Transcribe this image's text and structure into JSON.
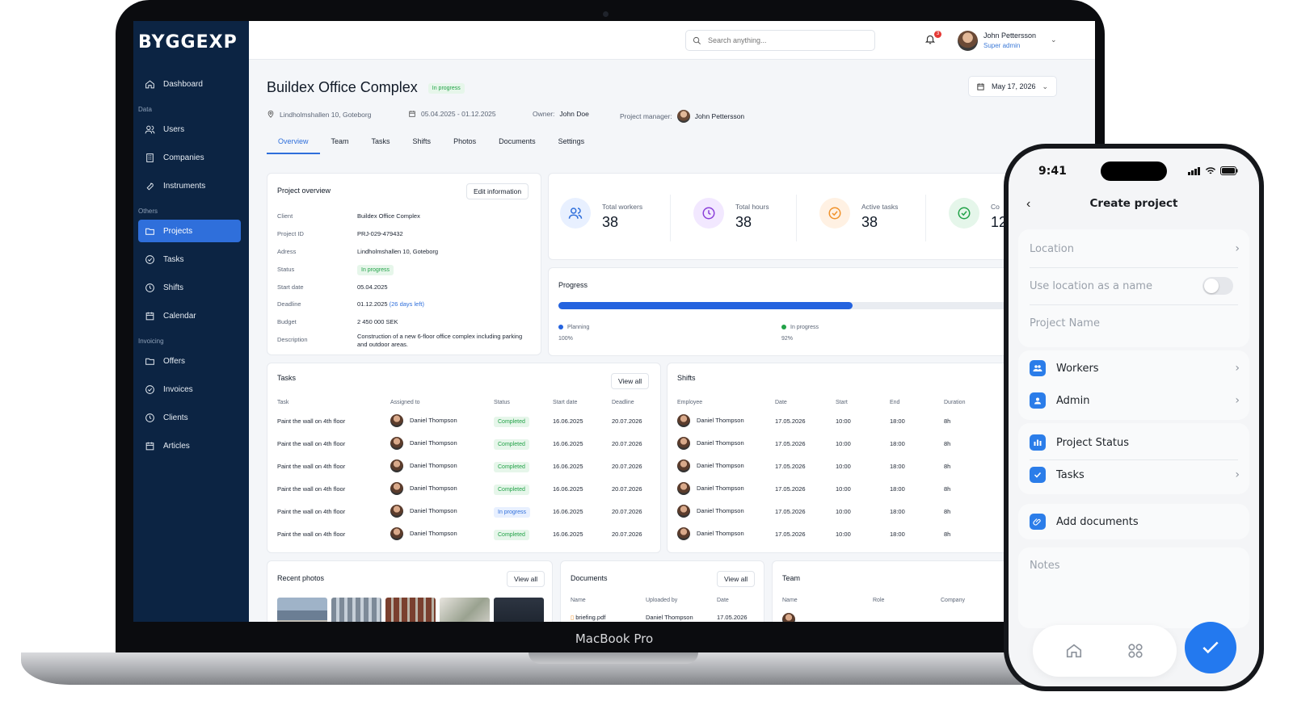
{
  "device": {
    "laptop_label": "MacBook Pro"
  },
  "app": {
    "brand": "BYGGEXP",
    "search_placeholder": "Search anything...",
    "notification_count": "3",
    "user": {
      "name": "John Pettersson",
      "role": "Super admin"
    }
  },
  "sidebar": {
    "dashboard": "Dashboard",
    "group_data": "Data",
    "users": "Users",
    "companies": "Companies",
    "instruments": "Instruments",
    "group_others": "Others",
    "projects": "Projects",
    "tasks": "Tasks",
    "shifts": "Shifts",
    "calendar": "Calendar",
    "group_invoicing": "Invoicing",
    "offers": "Offers",
    "invoices": "Invoices",
    "clients": "Clients",
    "articles": "Articles"
  },
  "header": {
    "title": "Buildex Office Complex",
    "status": "In progress",
    "address": "Lindholmshallen 10, Goteborg",
    "dates": "05.04.2025 - 01.12.2025",
    "owner_label": "Owner:",
    "owner": "John Doe",
    "pm_label": "Project manager:",
    "pm": "John Pettersson",
    "date_picker": "May 17, 2026"
  },
  "tabs": [
    "Overview",
    "Team",
    "Tasks",
    "Shifts",
    "Photos",
    "Documents",
    "Settings"
  ],
  "overview": {
    "title": "Project overview",
    "edit_button": "Edit information",
    "rows": {
      "client_label": "Client",
      "client": "Buildex Office Complex",
      "id_label": "Project ID",
      "id": "PRJ-029-479432",
      "address_label": "Adress",
      "address": "Lindholmshallen 10, Goteborg",
      "status_label": "Status",
      "status": "In progress",
      "start_label": "Start date",
      "start": "05.04.2025",
      "deadline_label": "Deadline",
      "deadline": "01.12.2025",
      "deadline_note": "(26 days left)",
      "budget_label": "Budget",
      "budget": "2 450 000 SEK",
      "description_label": "Description",
      "description": "Construction of a new 6-floor office complex including parking and outdoor areas."
    }
  },
  "stats": [
    {
      "label": "Total workers",
      "value": "38"
    },
    {
      "label": "Total hours",
      "value": "38"
    },
    {
      "label": "Active tasks",
      "value": "38"
    },
    {
      "label": "Co",
      "value": "12"
    }
  ],
  "progress": {
    "title": "Progress",
    "fill_fraction": 0.65,
    "planning_label": "Planning",
    "planning_value": "100%",
    "inprogress_label": "In progress",
    "inprogress_value": "92%"
  },
  "tasks": {
    "title": "Tasks",
    "view_all": "View all",
    "headers": [
      "Task",
      "Assigned to",
      "Status",
      "Start date",
      "Deadline"
    ],
    "rows": [
      [
        "Paint the wall on 4th floor",
        "Daniel Thompson",
        "Completed",
        "16.06.2025",
        "20.07.2026"
      ],
      [
        "Paint the wall on 4th floor",
        "Daniel Thompson",
        "Completed",
        "16.06.2025",
        "20.07.2026"
      ],
      [
        "Paint the wall on 4th floor",
        "Daniel Thompson",
        "Completed",
        "16.06.2025",
        "20.07.2026"
      ],
      [
        "Paint the wall on 4th floor",
        "Daniel Thompson",
        "Completed",
        "16.06.2025",
        "20.07.2026"
      ],
      [
        "Paint the wall on 4th floor",
        "Daniel Thompson",
        "In progress",
        "16.06.2025",
        "20.07.2026"
      ],
      [
        "Paint the wall on 4th floor",
        "Daniel Thompson",
        "Completed",
        "16.06.2025",
        "20.07.2026"
      ]
    ]
  },
  "shifts": {
    "title": "Shifts",
    "headers": [
      "Employee",
      "Date",
      "Start",
      "End",
      "Duration"
    ],
    "rows": [
      [
        "Daniel Thompson",
        "17.05.2026",
        "10:00",
        "18:00",
        "8h"
      ],
      [
        "Daniel Thompson",
        "17.05.2026",
        "10:00",
        "18:00",
        "8h"
      ],
      [
        "Daniel Thompson",
        "17.05.2026",
        "10:00",
        "18:00",
        "8h"
      ],
      [
        "Daniel Thompson",
        "17.05.2026",
        "10:00",
        "18:00",
        "8h"
      ],
      [
        "Daniel Thompson",
        "17.05.2026",
        "10:00",
        "18:00",
        "8h"
      ],
      [
        "Daniel Thompson",
        "17.05.2026",
        "10:00",
        "18:00",
        "8h"
      ]
    ]
  },
  "photos": {
    "title": "Recent photos",
    "view_all": "View all"
  },
  "documents": {
    "title": "Documents",
    "view_all": "View all",
    "headers": [
      "Name",
      "Uploaded by",
      "Date"
    ],
    "row": [
      "briefing.pdf",
      "Daniel Thompson",
      "17.05.2026"
    ]
  },
  "team": {
    "title": "Team",
    "headers": [
      "Name",
      "Role",
      "Company"
    ]
  },
  "phone": {
    "time": "9:41",
    "title": "Create project",
    "location": "Location",
    "use_location": "Use location as a name",
    "project_name": "Project Name",
    "workers": "Workers",
    "admin": "Admin",
    "project_status": "Project Status",
    "tasks": "Tasks",
    "add_documents": "Add documents",
    "notes": "Notes"
  },
  "colors": {
    "sidebar": "#0c2443",
    "accent": "#2f6fdb",
    "success": "#22a248",
    "fab": "#2379ef"
  }
}
